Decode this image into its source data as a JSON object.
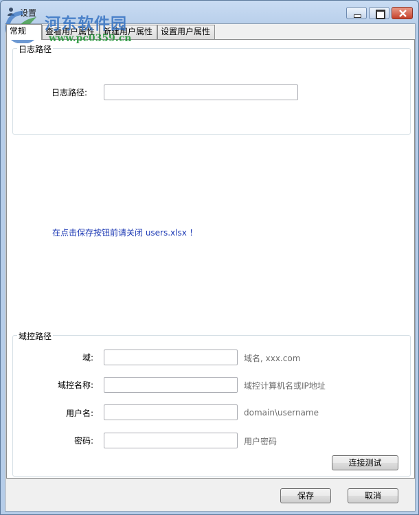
{
  "window": {
    "title": "设置",
    "controls": [
      "minimize",
      "maximize",
      "close"
    ]
  },
  "watermark": {
    "name": "河东软件园",
    "url": "www.pc0359.cn"
  },
  "tabs": [
    {
      "label": "常规",
      "active": true
    },
    {
      "label": "查看用户属性",
      "active": false
    },
    {
      "label": "新建用户属性",
      "active": false
    },
    {
      "label": "设置用户属性",
      "active": false
    }
  ],
  "log_group": {
    "title": "日志路径",
    "field_label": "日志路径:",
    "field_value": ""
  },
  "notice": "在点击保存按钮前请关闭 users.xlsx ！",
  "domain_group": {
    "title": "域控路径",
    "fields": [
      {
        "label": "域:",
        "value": "",
        "hint": "域名, xxx.com"
      },
      {
        "label": "域控名称:",
        "value": "",
        "hint": "域控计算机名或IP地址"
      },
      {
        "label": "用户名:",
        "value": "",
        "hint": "domain\\username"
      },
      {
        "label": "密码:",
        "value": "",
        "hint": "用户密码"
      }
    ],
    "test_button": "连接测试"
  },
  "footer": {
    "save_button": "保存",
    "cancel_button": "取消"
  }
}
